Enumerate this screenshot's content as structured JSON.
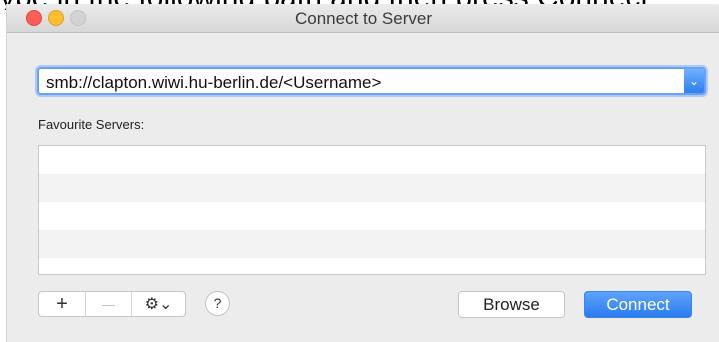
{
  "caption_partial": "ype in the following path and then press Connect:",
  "window": {
    "title": "Connect to Server"
  },
  "address": {
    "value": "smb://clapton.wiwi.hu-berlin.de/<Username>"
  },
  "favourites": {
    "label": "Favourite Servers:",
    "items": []
  },
  "toolbar": {
    "add_label": "+",
    "remove_label": "—",
    "settings_label": "⚙⌄",
    "help_label": "?"
  },
  "buttons": {
    "browse_label": "Browse",
    "connect_label": "Connect"
  },
  "colors": {
    "accent": "#2b7cf0",
    "close": "#fd5f57",
    "minimize": "#febc2e"
  }
}
